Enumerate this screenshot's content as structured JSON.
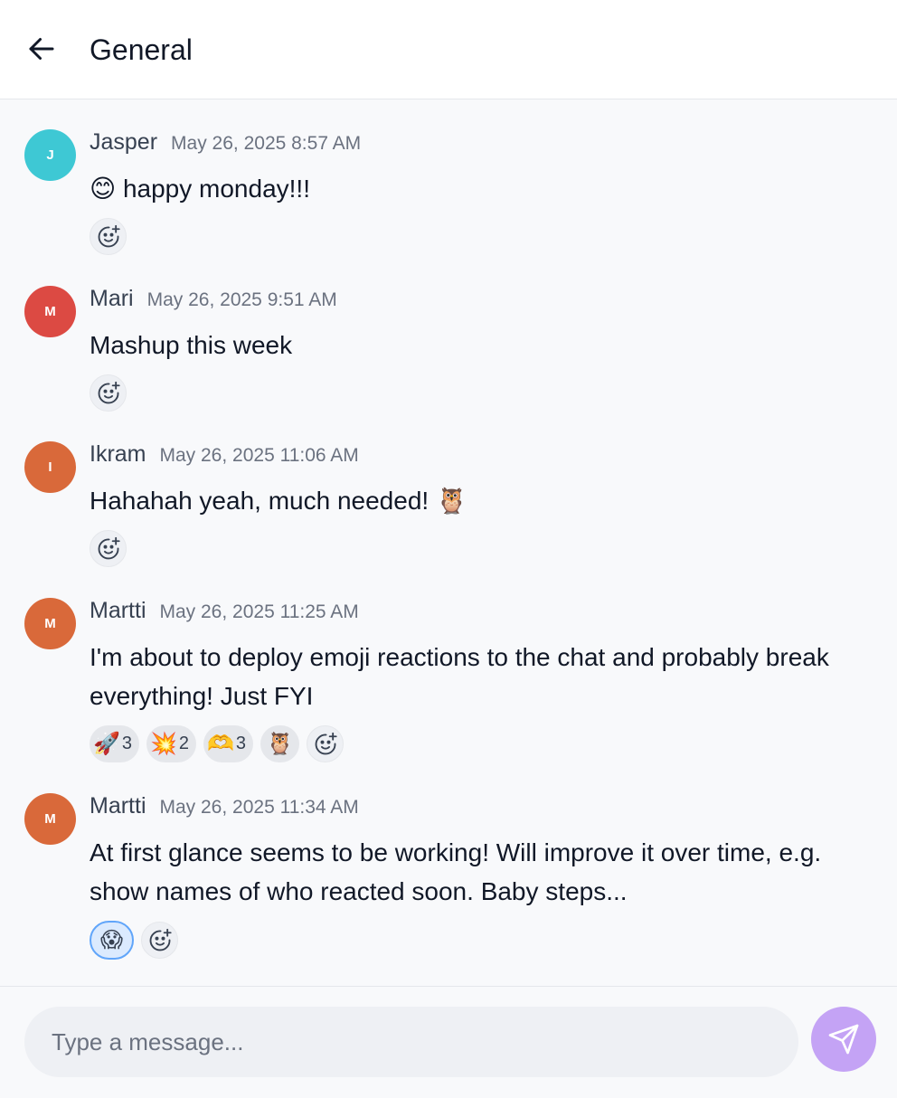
{
  "header": {
    "title": "General"
  },
  "colors": {
    "avatar_teal": "#3ec8d4",
    "avatar_red": "#dc4a43",
    "avatar_orange": "#d9693a",
    "send_button": "#c4a3f5"
  },
  "messages": [
    {
      "author": "Jasper",
      "initial": "J",
      "timestamp": "May 26, 2025 8:57 AM",
      "text": "😊 happy monday!!!",
      "reactions": []
    },
    {
      "author": "Mari",
      "initial": "M",
      "timestamp": "May 26, 2025 9:51 AM",
      "text": "Mashup this week",
      "reactions": []
    },
    {
      "author": "Ikram",
      "initial": "I",
      "timestamp": "May 26, 2025 11:06 AM",
      "text": "Hahahah yeah, much needed! 🦉",
      "reactions": []
    },
    {
      "author": "Martti",
      "initial": "M",
      "timestamp": "May 26, 2025 11:25 AM",
      "text": "I'm about to deploy emoji reactions to the chat and probably break everything! Just FYI",
      "reactions": [
        {
          "emoji": "🚀",
          "count": "3"
        },
        {
          "emoji": "💥",
          "count": "2"
        },
        {
          "emoji": "🫶",
          "count": "3"
        },
        {
          "emoji": "🦉",
          "count": ""
        }
      ]
    },
    {
      "author": "Martti",
      "initial": "M",
      "timestamp": "May 26, 2025 11:34 AM",
      "text": "At first glance seems to be working! Will improve it over time, e.g. show names of who reacted soon. Baby steps...",
      "reactions": [
        {
          "emoji": "😱",
          "count": ""
        }
      ]
    }
  ],
  "composer": {
    "placeholder": "Type a message..."
  }
}
